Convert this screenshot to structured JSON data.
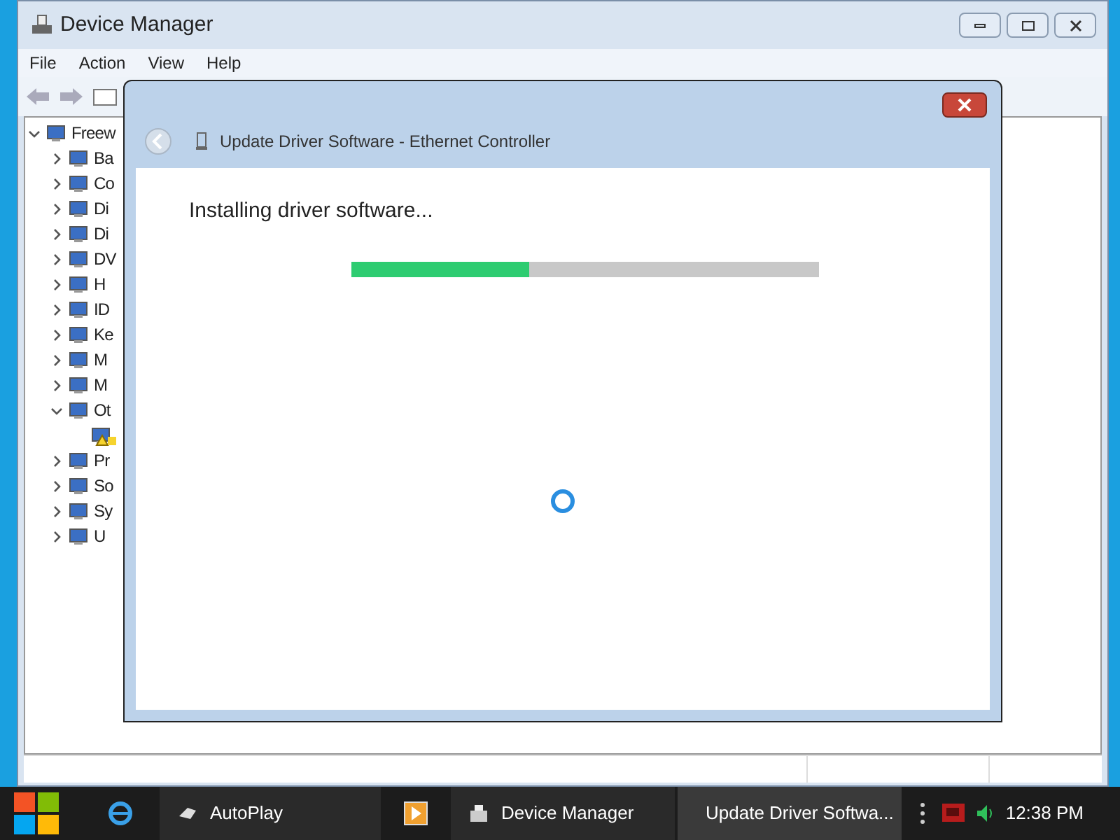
{
  "window": {
    "title": "Device Manager"
  },
  "menu": [
    "File",
    "Action",
    "View",
    "Help"
  ],
  "tree": {
    "label": "Freew",
    "expanded": true,
    "children": [
      {
        "label": "Ba",
        "expanded": false
      },
      {
        "label": "Co",
        "expanded": false
      },
      {
        "label": "Di",
        "expanded": false
      },
      {
        "label": "Di",
        "expanded": false
      },
      {
        "label": "DV",
        "expanded": false
      },
      {
        "label": "H",
        "expanded": false
      },
      {
        "label": "ID",
        "expanded": false
      },
      {
        "label": "Ke",
        "expanded": false
      },
      {
        "label": "M",
        "expanded": false
      },
      {
        "label": "M",
        "expanded": false
      },
      {
        "label": "Ot",
        "expanded": true,
        "children": [
          {
            "warning": true
          }
        ]
      },
      {
        "label": "Pr",
        "expanded": false
      },
      {
        "label": "So",
        "expanded": false
      },
      {
        "label": "Sy",
        "expanded": false
      },
      {
        "label": "U",
        "expanded": false
      }
    ]
  },
  "dialog": {
    "title": "Update Driver Software - Ethernet Controller",
    "heading": "Installing driver software...",
    "progress": {
      "level": 0.38
    }
  },
  "taskbar": {
    "items": [
      {
        "label": "AutoPlay",
        "selected": false
      },
      {
        "label": "Device Manager",
        "selected": false
      },
      {
        "label": "Update Driver Softwa...",
        "selected": true
      }
    ],
    "clock": "12:38 PM"
  }
}
